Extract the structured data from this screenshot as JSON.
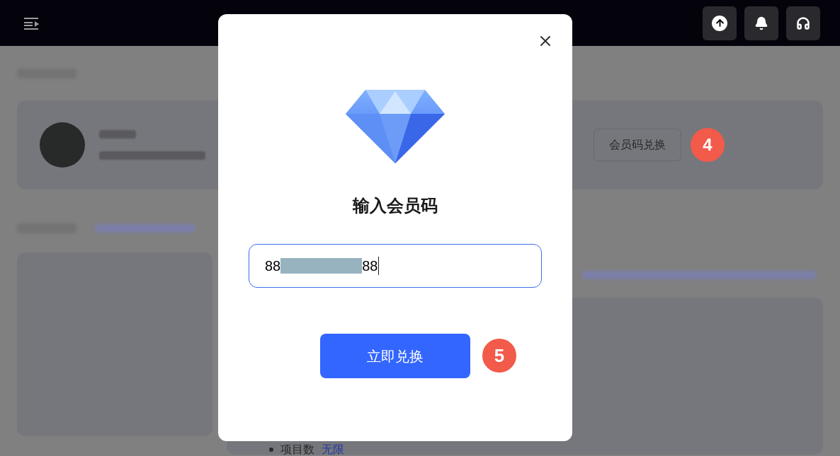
{
  "top_bar": {
    "actions": [
      {
        "kind": "upload"
      },
      {
        "kind": "bell"
      },
      {
        "kind": "headset"
      }
    ]
  },
  "account_card": {
    "redeem_button": "会员码兑换",
    "step_badge": "4"
  },
  "plan_list": {
    "item_label": "项目数",
    "item_value": "无限"
  },
  "dialog": {
    "title": "输入会员码",
    "code_field": {
      "value": "88",
      "value_end": "88",
      "redacted": true
    },
    "submit_button": "立即兑换",
    "step_badge": "5"
  }
}
